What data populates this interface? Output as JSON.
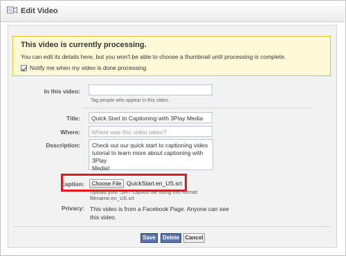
{
  "dialog": {
    "title": "Edit Video",
    "title_icon": "video-camera-icon"
  },
  "notice": {
    "title": "This video is currently processing.",
    "text": "You can edit its details here, but you won't be able to choose a thumbnail until processing is complete.",
    "checkbox_label": "Notify me when my video is done processing",
    "checkbox_checked": true
  },
  "form": {
    "in_this_video": {
      "label": "In this video:",
      "value": "",
      "hint": "Tag people who appear in this video."
    },
    "title": {
      "label": "Title:",
      "value": "Quick Start to Captioning with 3Play Media"
    },
    "where": {
      "label": "Where:",
      "placeholder": "Where was this video taken?"
    },
    "description": {
      "label": "Description:",
      "lines": [
        "Check out our quick start to captioning video",
        "tutorial to learn more about captioning with 3Play",
        "Media!"
      ]
    },
    "caption": {
      "label": "Caption:",
      "button_label": "Choose File",
      "file_name": "QuickStart.en_US.srt",
      "hint_line1": "Upload your .SRT caption file using this format:",
      "hint_line2": "filename.en_US.srt"
    },
    "privacy": {
      "label": "Privacy:",
      "text": "This video is from a Facebook Page. Anyone can see this video."
    }
  },
  "buttons": {
    "save": "Save",
    "delete": "Delete",
    "cancel": "Cancel"
  },
  "colors": {
    "notice_bg": "#fff9d7",
    "highlight": "#e2161b",
    "primary_button": "#5b74a8"
  }
}
